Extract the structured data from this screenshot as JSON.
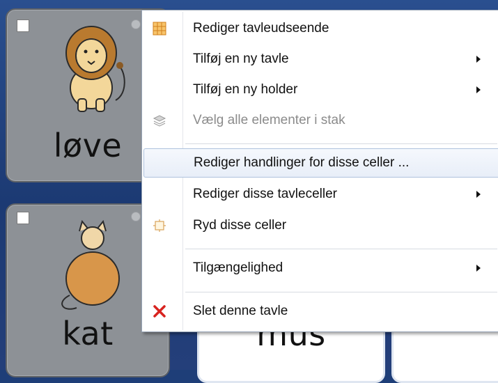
{
  "cells": {
    "top_left_label": "løve",
    "bottom_left_label": "kat",
    "bottom_mid_label": "mus"
  },
  "menu": {
    "items": [
      {
        "label": "Rediger tavleudseende",
        "icon": "grid-icon",
        "submenu": false,
        "enabled": true
      },
      {
        "label": "Tilføj en ny tavle",
        "submenu": true,
        "enabled": true
      },
      {
        "label": "Tilføj en ny holder",
        "submenu": true,
        "enabled": true
      },
      {
        "label": "Vælg alle elementer i stak",
        "icon": "stack-icon",
        "submenu": false,
        "enabled": false
      },
      {
        "label": "Rediger handlinger for disse celler ...",
        "submenu": false,
        "enabled": true,
        "highlighted": true
      },
      {
        "label": "Rediger disse tavleceller",
        "submenu": true,
        "enabled": true
      },
      {
        "label": "Ryd disse celler",
        "icon": "clear-cells-icon",
        "submenu": false,
        "enabled": true
      },
      {
        "label": "Tilgængelighed",
        "submenu": true,
        "enabled": true
      },
      {
        "label": "Slet denne tavle",
        "icon": "delete-x-icon",
        "submenu": false,
        "enabled": true
      }
    ]
  },
  "colors": {
    "delete_red": "#d8231f",
    "grid_orange": "#e89a2a",
    "highlight_border": "#aec2dd"
  }
}
